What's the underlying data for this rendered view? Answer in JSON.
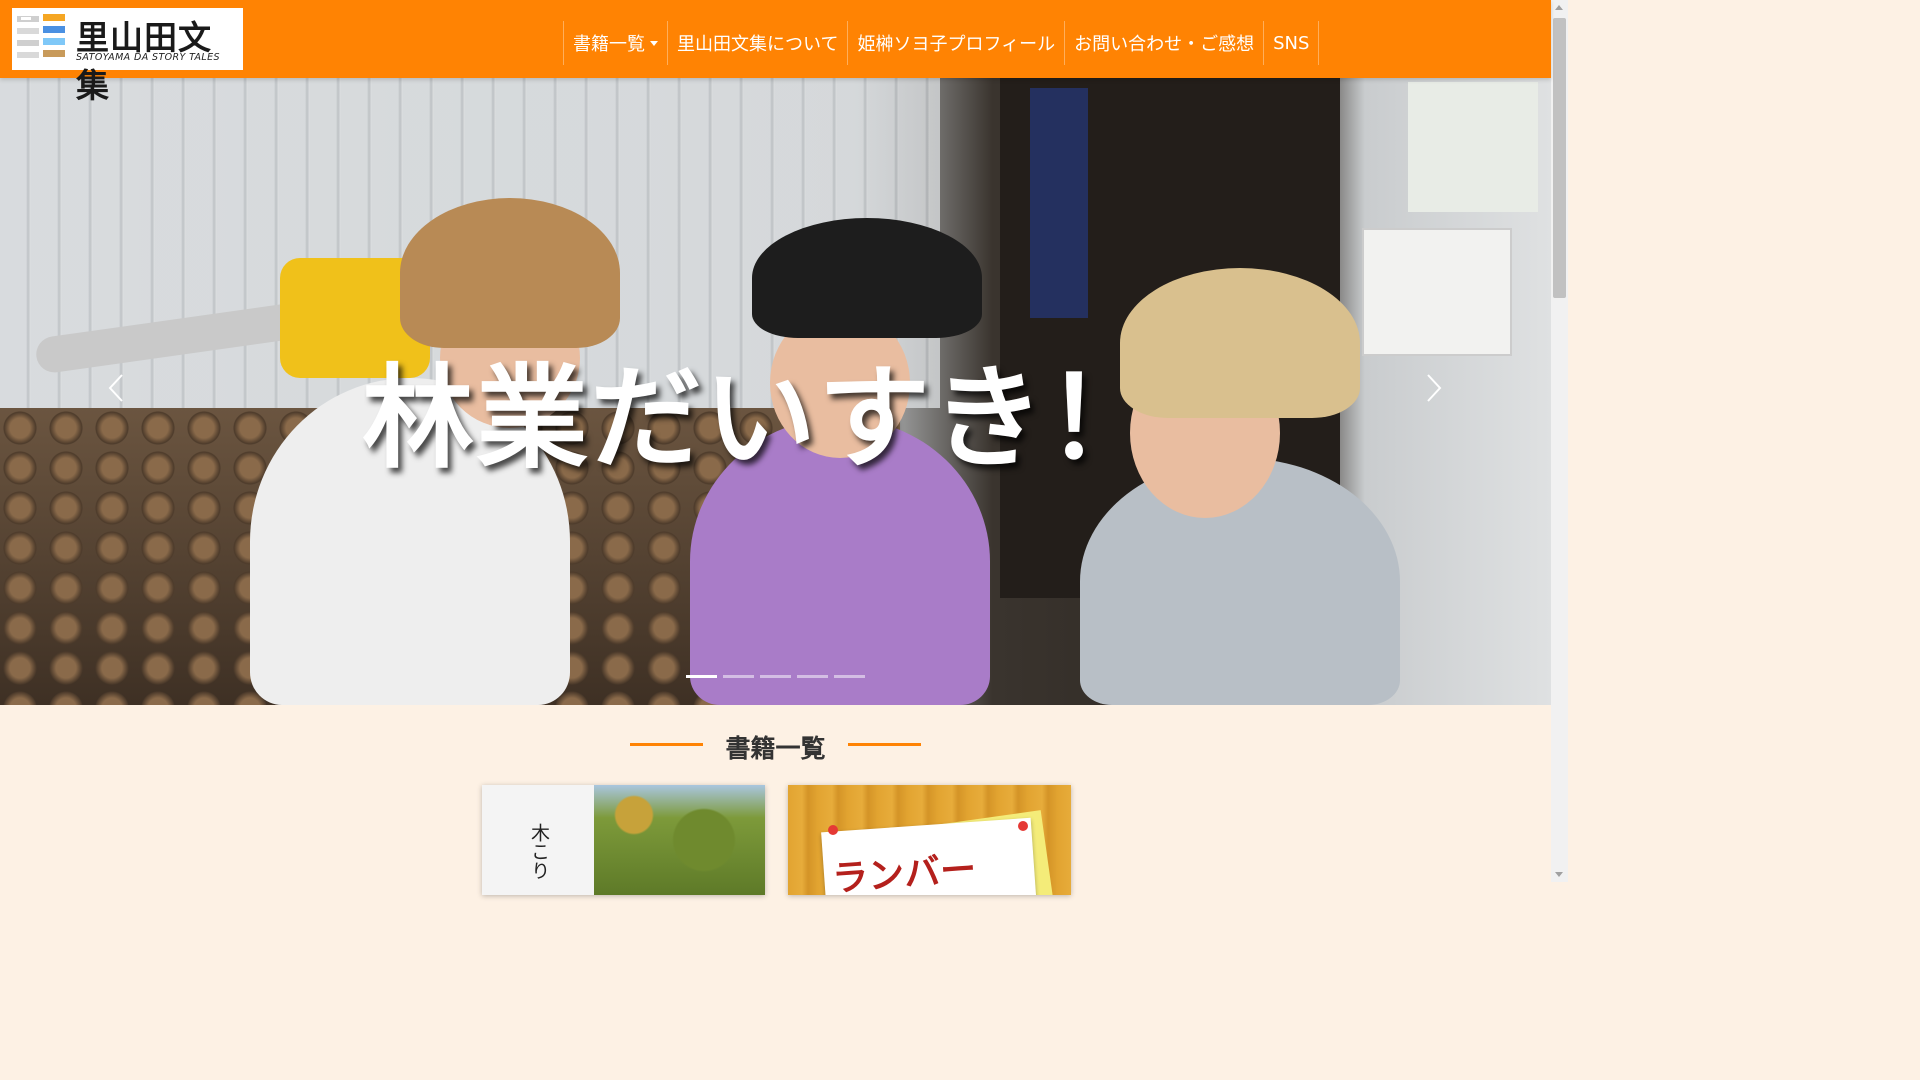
{
  "header": {
    "logo": {
      "title": "里山田文集",
      "subtitle": "SATOYAMA DA STORY TALES",
      "icon": "book-stack-logo-icon"
    },
    "nav": [
      {
        "label": "書籍一覧",
        "has_dropdown": true
      },
      {
        "label": "里山田文集について"
      },
      {
        "label": "姫榊ソヨ子プロフィール"
      },
      {
        "label": "お問い合わせ・ご感想"
      },
      {
        "label": "SNS"
      }
    ],
    "colors": {
      "background": "#ff8303",
      "text": "#ffffff"
    }
  },
  "hero": {
    "caption": "林業だいすき！",
    "prev_icon": "chevron-left-icon",
    "next_icon": "chevron-right-icon",
    "slide_count": 5,
    "active_slide": 1
  },
  "books_section": {
    "heading": "書籍一覧",
    "accent_color": "#ff8303",
    "books": [
      {
        "title_partial": "木こり"
      },
      {
        "title_partial": "ランバー"
      }
    ]
  }
}
